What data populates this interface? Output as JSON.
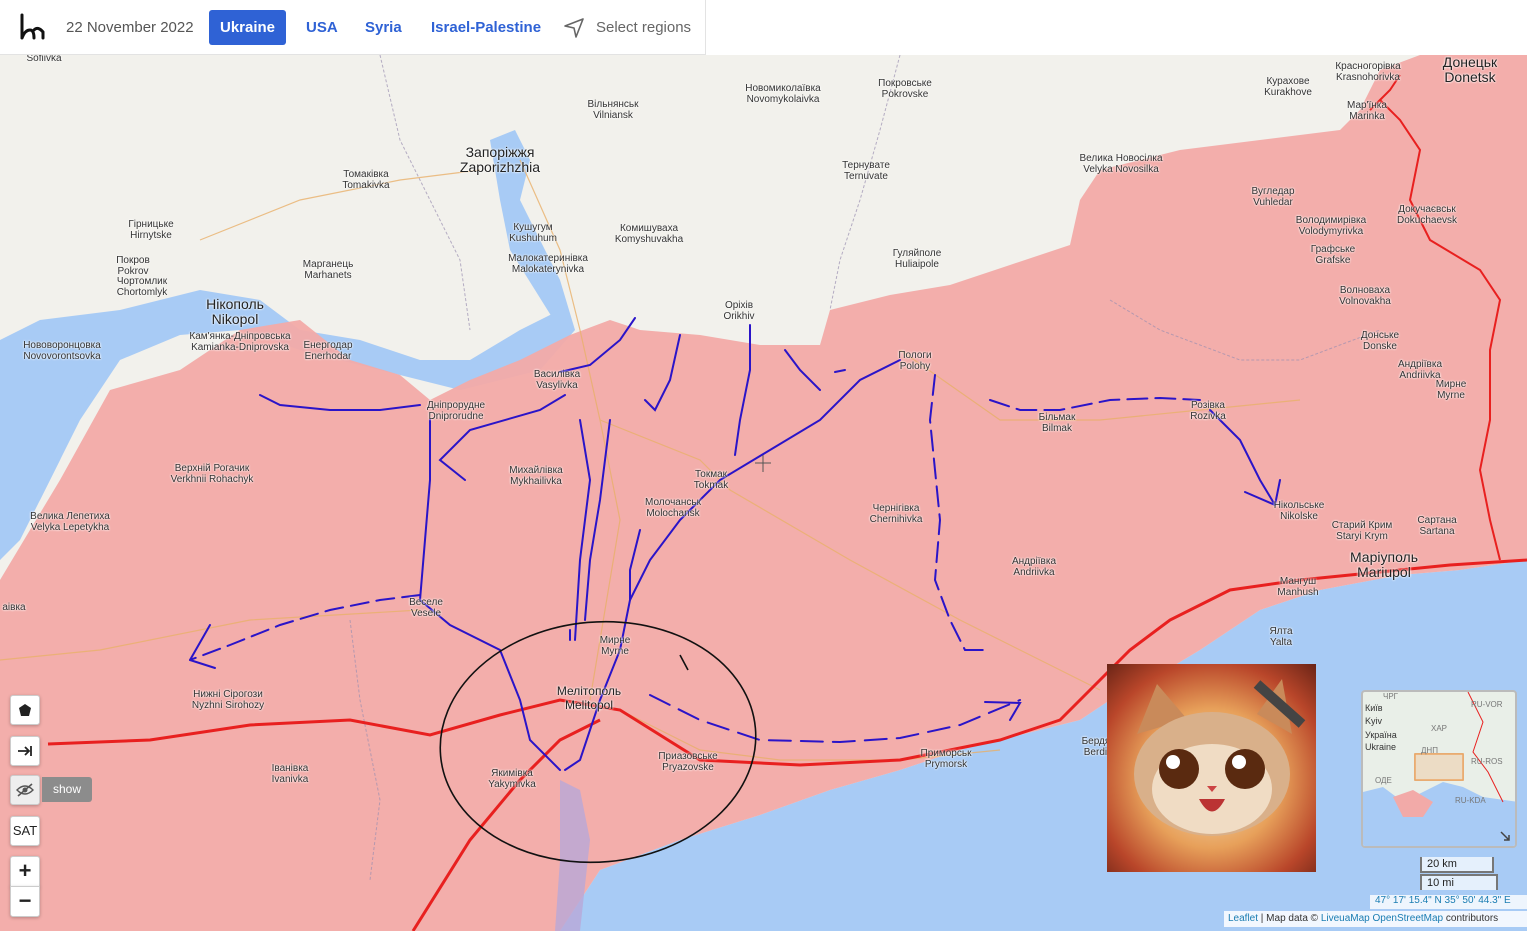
{
  "header": {
    "date": "22 November 2022",
    "tabs": [
      {
        "label": "Ukraine",
        "active": true
      },
      {
        "label": "USA",
        "active": false
      },
      {
        "label": "Syria",
        "active": false
      },
      {
        "label": "Israel-Palestine",
        "active": false
      }
    ],
    "select_regions": "Select regions"
  },
  "map": {
    "colors": {
      "occupied": "#f2aaa8",
      "water": "#a8cbf5",
      "land": "#f2f1ec",
      "frontline_arrows": "#2a14c8",
      "front_red": "#e8201f"
    },
    "labels": [
      {
        "id": "zaporizhzhia",
        "uk": "Запоріжжя",
        "en": "Zaporizhzhia",
        "big": true
      },
      {
        "id": "sofiivka",
        "uk": "",
        "en": "Sofiivka"
      },
      {
        "id": "vilniansk",
        "uk": "Вільнянськ",
        "en": "Vilniansk"
      },
      {
        "id": "novomykolaivka",
        "uk": "Новомиколаївка",
        "en": "Novomykolaivka"
      },
      {
        "id": "pokrovske",
        "uk": "Покровське",
        "en": "Pokrovske"
      },
      {
        "id": "kurakhove",
        "uk": "Курахове",
        "en": "Kurakhove"
      },
      {
        "id": "krasnohorivka",
        "uk": "Красногорівка",
        "en": "Krasnohorivka"
      },
      {
        "id": "donetsk",
        "uk": "Донецьк",
        "en": "Donetsk",
        "big": true
      },
      {
        "id": "marinka",
        "uk": "Мар'їнка",
        "en": "Marinka"
      },
      {
        "id": "tomakivka",
        "uk": "Томаківка",
        "en": "Tomakivka"
      },
      {
        "id": "ternuvate",
        "uk": "Тернувате",
        "en": "Ternuvate"
      },
      {
        "id": "novosilka",
        "uk": "Велика Новосілка",
        "en": "Velyka Novosilka"
      },
      {
        "id": "vuhledar",
        "uk": "Вугледар",
        "en": "Vuhledar"
      },
      {
        "id": "dokuchaievsk",
        "uk": "Докучаєвськ",
        "en": "Dokuchaevsk"
      },
      {
        "id": "hirnytske",
        "uk": "Гірницьке",
        "en": "Hirnytske"
      },
      {
        "id": "kushuhum",
        "uk": "Кушугум",
        "en": "Kushuhum"
      },
      {
        "id": "komyshuvakha",
        "uk": "Комишуваха",
        "en": "Komyshuvakha"
      },
      {
        "id": "volodymyrivka",
        "uk": "Володимирівка",
        "en": "Volodymyrivka"
      },
      {
        "id": "pokrov",
        "uk": "Покров",
        "en": "Pokrov"
      },
      {
        "id": "chortomlyk",
        "uk": "Чортомлик",
        "en": "Chortomlyk"
      },
      {
        "id": "marhanets",
        "uk": "Марганець",
        "en": "Marhanets"
      },
      {
        "id": "malokaterynivka",
        "uk": "Малокатеринівка",
        "en": "Malokaterynivka"
      },
      {
        "id": "huliaipole",
        "uk": "Гуляйполе",
        "en": "Huliaipole"
      },
      {
        "id": "grafske",
        "uk": "Графське",
        "en": "Grafske"
      },
      {
        "id": "nikopol",
        "uk": "Нікополь",
        "en": "Nikopol",
        "big": true
      },
      {
        "id": "orikhiv",
        "uk": "Оріхів",
        "en": "Orikhiv"
      },
      {
        "id": "volnovakha",
        "uk": "Волновахa",
        "en": "Volnovakha"
      },
      {
        "id": "novovorontsovka",
        "uk": "Нововоронцовка",
        "en": "Novovorontsovka"
      },
      {
        "id": "kamianka",
        "uk": "Кам'янка-Дніпровська",
        "en": "Kamianka-Dniprovska"
      },
      {
        "id": "enerhodar",
        "uk": "Енергодар",
        "en": "Enerhodar"
      },
      {
        "id": "vasylivka",
        "uk": "Василівка",
        "en": "Vasylivka"
      },
      {
        "id": "polohy",
        "uk": "Пологи",
        "en": "Polohy"
      },
      {
        "id": "donske",
        "uk": "Донське",
        "en": "Donske"
      },
      {
        "id": "andriivka2",
        "uk": "Андріївка",
        "en": "Andriivka"
      },
      {
        "id": "myrne2",
        "uk": "Мирне",
        "en": "Myrne"
      },
      {
        "id": "dniprorudne",
        "uk": "Дніпрорудне",
        "en": "Dniprorudne"
      },
      {
        "id": "bilmak",
        "uk": "Більмак",
        "en": "Bilmak"
      },
      {
        "id": "rozivka",
        "uk": "Розівка",
        "en": "Rozivka"
      },
      {
        "id": "rohachyk",
        "uk": "Верхній Рогачик",
        "en": "Verkhnii Rohachyk"
      },
      {
        "id": "mykhailivka",
        "uk": "Михайлівка",
        "en": "Mykhailivka"
      },
      {
        "id": "tokmak",
        "uk": "Токмак",
        "en": "Tokmak"
      },
      {
        "id": "molochansk",
        "uk": "Молочанськ",
        "en": "Molochansk"
      },
      {
        "id": "chernihivka",
        "uk": "Чернігівка",
        "en": "Chernihivka"
      },
      {
        "id": "nikolske",
        "uk": "Нікольське",
        "en": "Nikolske"
      },
      {
        "id": "lepetykha",
        "uk": "Велика Лепетиха",
        "en": "Velyka Lepetykha"
      },
      {
        "id": "staryi-krym",
        "uk": "Старий Крим",
        "en": "Staryi Krym"
      },
      {
        "id": "sartana",
        "uk": "Сартана",
        "en": "Sartana"
      },
      {
        "id": "andriivka",
        "uk": "Андріївка",
        "en": "Andriivka"
      },
      {
        "id": "mariupol",
        "uk": "Маріуполь",
        "en": "Mariupol",
        "big": true
      },
      {
        "id": "manhush",
        "uk": "Мангуш",
        "en": "Manhush"
      },
      {
        "id": "vesele",
        "uk": "Веселе",
        "en": "Vesele"
      },
      {
        "id": "kaviaka",
        "uk": "",
        "en": "аівка"
      },
      {
        "id": "myrne",
        "uk": "Мирне",
        "en": "Myrne"
      },
      {
        "id": "yalta",
        "uk": "Ялта",
        "en": "Yalta"
      },
      {
        "id": "sirohozy",
        "uk": "Нижні Сірогози",
        "en": "Nyzhni Sirohozy"
      },
      {
        "id": "melitopol",
        "uk": "Мелітополь",
        "en": "Melitopol",
        "big": true
      },
      {
        "id": "berdiansk",
        "uk": "Бердянськ",
        "en": "Berdiansk"
      },
      {
        "id": "pryazovske",
        "uk": "Приазовське",
        "en": "Pryazovske"
      },
      {
        "id": "prymorsk",
        "uk": "Приморськ",
        "en": "Prymorsk"
      },
      {
        "id": "ivanivka",
        "uk": "Іванівка",
        "en": "Ivanivka"
      },
      {
        "id": "yakymivka",
        "uk": "Якимівка",
        "en": "Yakymivka"
      }
    ]
  },
  "controls": {
    "draw_icon": "pentagon-icon",
    "expand_icon": "arrow-right-bar-icon",
    "hide_icon": "eye-off-icon",
    "show_label": "show",
    "sat_label": "SAT",
    "zoom_in": "+",
    "zoom_out": "−"
  },
  "minimap": {
    "labels": [
      "Київ",
      "Kyiv",
      "Україна",
      "Ukraine"
    ],
    "grey_labels": [
      "ЧРГ",
      "RU-VOR",
      "ХАР",
      "ДНП",
      "RU-ROS",
      "ОДЕ",
      "RU-KDA"
    ]
  },
  "scale": {
    "metric": "20 km",
    "imperial": "10 mi"
  },
  "coordinates": "47° 17' 15.4\" N 35° 50' 44.3\" E",
  "attribution": {
    "leaflet": "Leaflet",
    "sep": " | Map data © ",
    "liveua": "LiveuaMap",
    "osm": "OpenStreetMap",
    "contrib": " contributors"
  }
}
